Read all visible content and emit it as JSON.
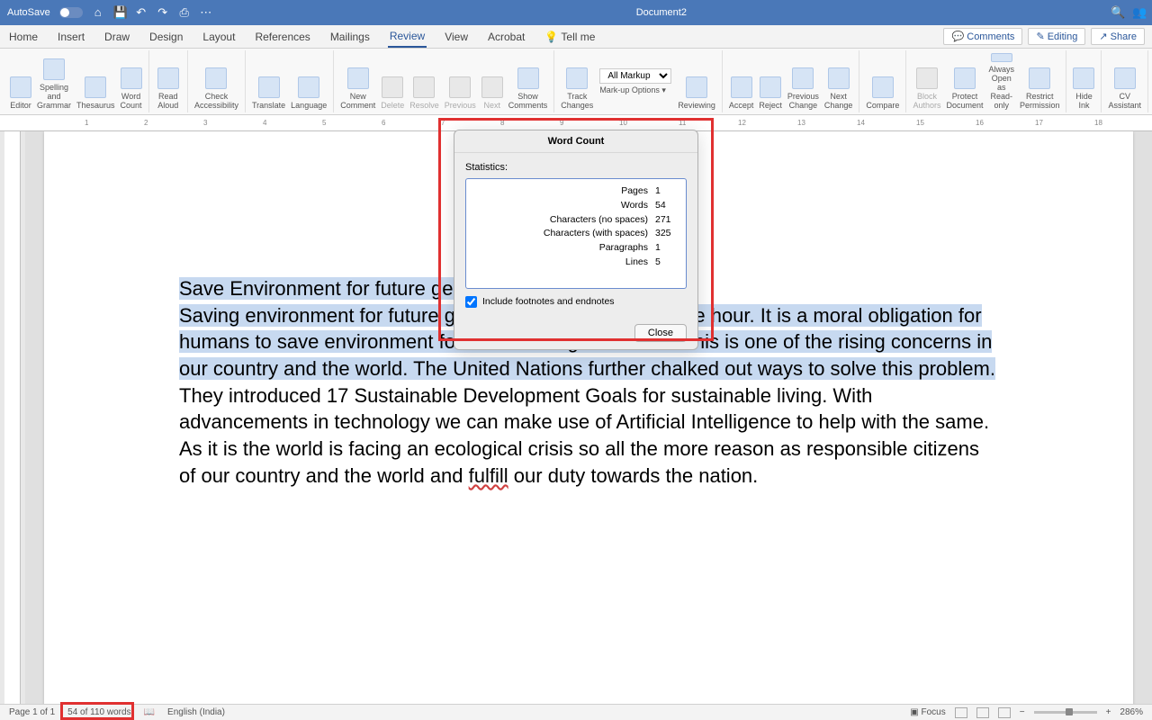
{
  "titleBar": {
    "autosave": "AutoSave",
    "autosaveState": "OFF",
    "docTitle": "Document2"
  },
  "tabs": {
    "items": [
      "Home",
      "Insert",
      "Draw",
      "Design",
      "Layout",
      "References",
      "Mailings",
      "Review",
      "View",
      "Acrobat",
      "Tell me"
    ],
    "activeIndex": 7,
    "comments": "Comments",
    "editing": "Editing",
    "share": "Share"
  },
  "ribbon": {
    "editor": "Editor",
    "spelling": "Spelling and\nGrammar",
    "thesaurus": "Thesaurus",
    "wordCount": "Word\nCount",
    "readAloud": "Read\nAloud",
    "checkAccess": "Check\nAccessibility",
    "translate": "Translate",
    "language": "Language",
    "newComment": "New\nComment",
    "delete": "Delete",
    "resolve": "Resolve",
    "previous": "Previous",
    "next": "Next",
    "showComments": "Show\nComments",
    "trackChanges": "Track\nChanges",
    "allMarkup": "All Markup",
    "markupOptions": "Mark-up Options",
    "reviewing": "Reviewing",
    "accept": "Accept",
    "reject": "Reject",
    "prevChange": "Previous\nChange",
    "nextChange": "Next\nChange",
    "compare": "Compare",
    "blockAuthors": "Block\nAuthors",
    "protectDoc": "Protect\nDocument",
    "alwaysOpen": "Always Open\nas Read-only",
    "restrict": "Restrict\nPermission",
    "hideInk": "Hide Ink",
    "assistant": "CV\nAssistant"
  },
  "dialog": {
    "title": "Word Count",
    "statsLabel": "Statistics:",
    "rows": [
      {
        "label": "Pages",
        "value": "1"
      },
      {
        "label": "Words",
        "value": "54"
      },
      {
        "label": "Characters (no spaces)",
        "value": "271"
      },
      {
        "label": "Characters (with spaces)",
        "value": "325"
      },
      {
        "label": "Paragraphs",
        "value": "1"
      },
      {
        "label": "Lines",
        "value": "5"
      }
    ],
    "includeFootnotes": "Include footnotes and endnotes",
    "close": "Close"
  },
  "document": {
    "h1a": "Save Environment for future gen",
    "line2a": "Saving environment for future ge",
    "line2b": "e hour. It is a moral obligation ",
    "line3a": "for humans to save environme",
    "line3mid": "nt for their future generations.",
    "line3b": " This is one of the rising ",
    "line4a": "concerns in our country and the world.  The United Nations further chalked out ways to ",
    "line5a": "solve this problem.",
    "rest1": " They introduced 17 Sustainable Development Goals for sustainable living. With advancements in technology we can make use of Artificial Intelligence to help with the same.   As it is the world is facing an ecological crisis so all the more reason as responsible citizens of our country and the world and ",
    "fulfill": "fulfill",
    "rest2": " our duty towards the nation."
  },
  "statusBar": {
    "page": "Page 1 of 1",
    "words": "54 of 110 words",
    "language": "English (India)",
    "focus": "Focus",
    "zoom": "286%"
  }
}
